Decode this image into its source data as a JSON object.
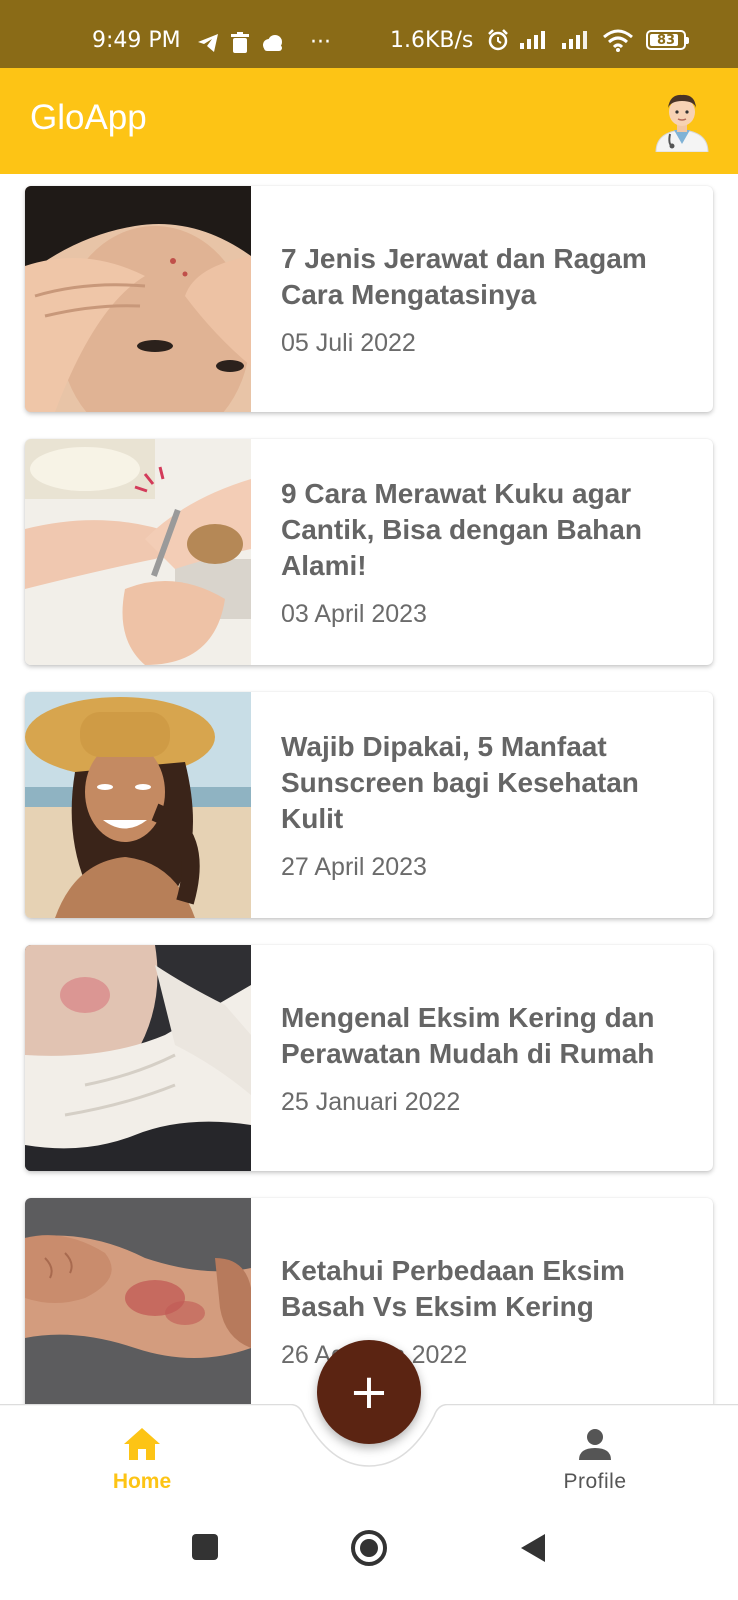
{
  "status_bar": {
    "time": "9:49 PM",
    "more": "···",
    "net_speed": "1.6KB/s",
    "battery": "83"
  },
  "app_bar": {
    "title": "GloApp",
    "avatar_icon": "doctor-avatar-icon"
  },
  "articles": [
    {
      "title": "7 Jenis Jerawat dan Ragam Cara Mengatasinya",
      "date": "05 Juli 2022"
    },
    {
      "title": "9 Cara Merawat Kuku agar Cantik, Bisa dengan Bahan Alami!",
      "date": "03 April 2023"
    },
    {
      "title": "Wajib Dipakai, 5 Manfaat Sunscreen bagi Kesehatan Kulit",
      "date": "27 April 2023"
    },
    {
      "title": "Mengenal Eksim Kering dan Perawatan Mudah di Rumah",
      "date": "25 Januari 2022"
    },
    {
      "title": "Ketahui Perbedaan Eksim Basah Vs Eksim Kering",
      "date": "26 Agustus 2022"
    }
  ],
  "fab": {
    "label": "+"
  },
  "bottom_nav": {
    "home_label": "Home",
    "profile_label": "Profile"
  },
  "colors": {
    "status_bar": "#8a6b17",
    "app_bar": "#fdc415",
    "fab": "#5b2412",
    "active_nav": "#fdc415"
  }
}
